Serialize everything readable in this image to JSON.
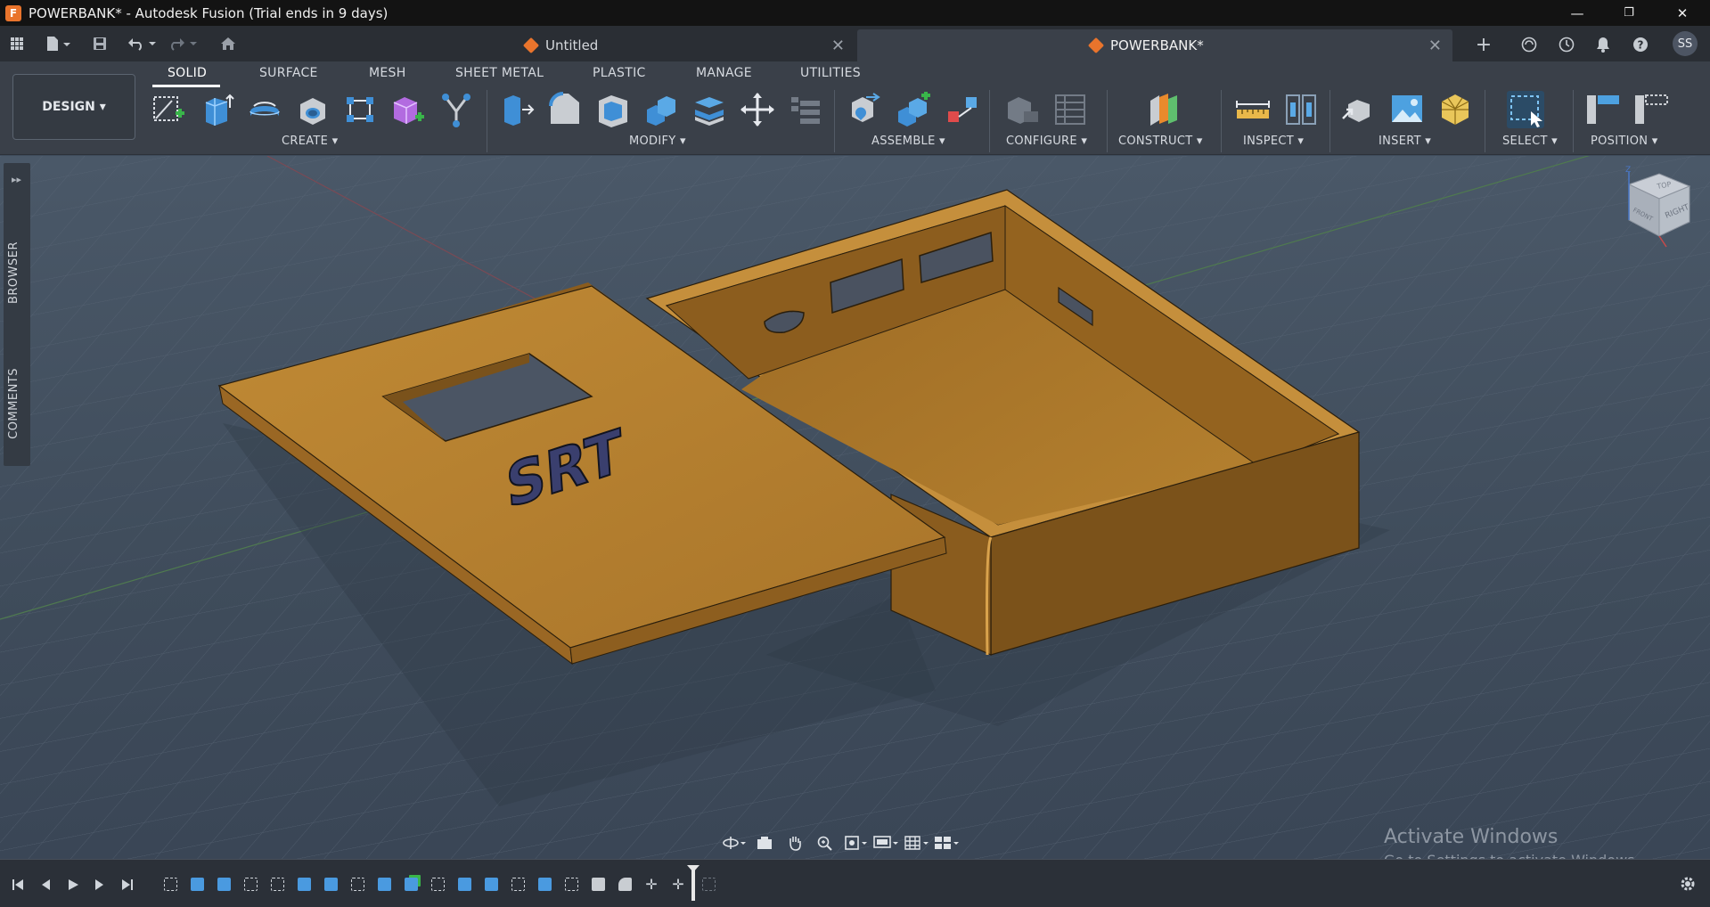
{
  "window": {
    "title": "POWERBANK* - Autodesk Fusion (Trial ends in 9 days)",
    "app_icon_letter": "F",
    "minimize": "—",
    "maximize": "❐",
    "close": "✕"
  },
  "tabs": [
    {
      "label": "Untitled",
      "close": "✕"
    },
    {
      "label": "POWERBANK*",
      "close": "✕"
    }
  ],
  "quick_access": {
    "grid_icon": "grid-icon",
    "file_icon": "file-icon",
    "save_icon": "save-icon",
    "undo_icon": "undo-icon",
    "redo_icon": "redo-icon",
    "home_icon": "home-icon"
  },
  "header_right": {
    "new_tab": "+",
    "avatar_initials": "SS"
  },
  "workspace": {
    "label": "DESIGN ▾"
  },
  "ribbon_tabs": [
    "SOLID",
    "SURFACE",
    "MESH",
    "SHEET METAL",
    "PLASTIC",
    "MANAGE",
    "UTILITIES"
  ],
  "groups": {
    "create": "CREATE ▾",
    "modify": "MODIFY ▾",
    "assemble": "ASSEMBLE ▾",
    "configure": "CONFIGURE ▾",
    "construct": "CONSTRUCT ▾",
    "inspect": "INSPECT ▾",
    "insert": "INSERT ▾",
    "select": "SELECT ▾",
    "position": "POSITION ▾"
  },
  "side_panel": {
    "browser": "BROWSER",
    "comments": "COMMENTS",
    "toggle": "▸▸"
  },
  "viewcube": {
    "top": "TOP",
    "right": "RIGHT",
    "front": "FRONT",
    "axis_z": "Z"
  },
  "model": {
    "embossed_text": "SRT"
  },
  "watermark": {
    "title": "Activate Windows",
    "subtitle": "Go to Settings to activate Windows."
  },
  "colors": {
    "accent_orange": "#e9742c",
    "model_brown": "#b07c2c",
    "select_highlight": "#5aa9e6"
  }
}
